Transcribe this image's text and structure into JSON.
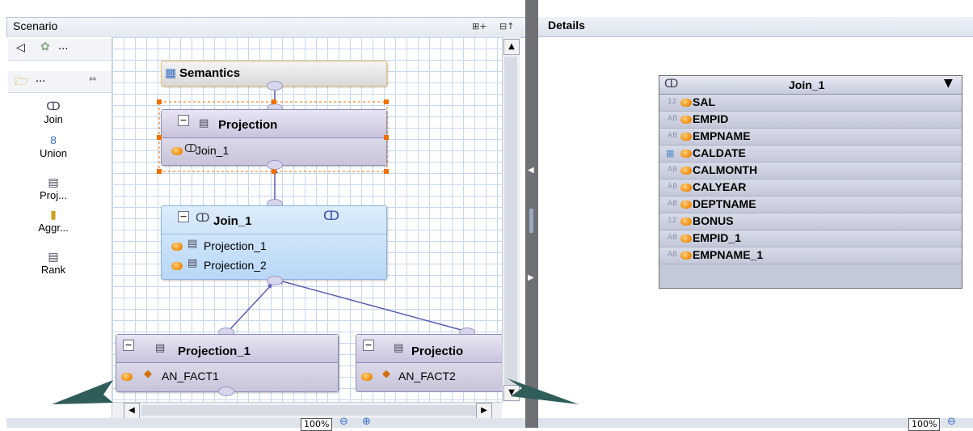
{
  "scenario": {
    "title": "Scenario",
    "expand_label": "⊞+",
    "collapse_label": "⊟↑"
  },
  "details": {
    "title": "Details"
  },
  "palette": {
    "top_more": "...",
    "second_more": "...",
    "tools": [
      {
        "label": "Join"
      },
      {
        "label": "Union"
      },
      {
        "label": "Proj..."
      },
      {
        "label": "Aggr..."
      },
      {
        "label": "Rank"
      }
    ]
  },
  "canvas": {
    "semantics": {
      "title": "Semantics"
    },
    "projection_top": {
      "title": "Projection",
      "input": "Join_1"
    },
    "join": {
      "title": "Join_1",
      "inputs": [
        "Projection_1",
        "Projection_2"
      ]
    },
    "projection_1": {
      "title": "Projection_1",
      "input": "AN_FACT1"
    },
    "projection_2": {
      "title": "Projectio",
      "input": "AN_FACT2"
    }
  },
  "details_table": {
    "title": "Join_1",
    "rows": [
      {
        "type": "12",
        "name": "SAL"
      },
      {
        "type": "AB",
        "name": "EMPID"
      },
      {
        "type": "AB",
        "name": "EMPNAME"
      },
      {
        "type": "CAL",
        "name": "CALDATE"
      },
      {
        "type": "AB",
        "name": "CALMONTH"
      },
      {
        "type": "AB",
        "name": "CALYEAR"
      },
      {
        "type": "AB",
        "name": "DEPTNAME"
      },
      {
        "type": "12",
        "name": "BONUS"
      },
      {
        "type": "AB",
        "name": "EMPID_1"
      },
      {
        "type": "AB",
        "name": "EMPNAME_1"
      }
    ]
  },
  "zoom": {
    "left": "100%",
    "right": "100%"
  },
  "colors": {
    "arrow": "#2f5d5a",
    "selection": "#f07000",
    "join_node": "#b9d8f7"
  }
}
